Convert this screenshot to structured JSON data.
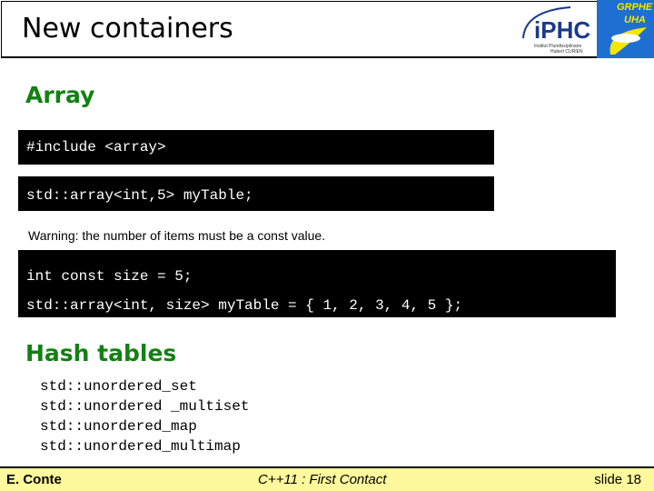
{
  "header": {
    "title": "New containers",
    "logo_iphc": "IPHC",
    "logo_iphc_sub": "Institut Pluridisciplinaire Hubert CURIEN STRASBOURG",
    "logo_grphe": "GRPHE UHA"
  },
  "array": {
    "heading": "Array",
    "code1": "#include <array>",
    "code2": "std::array<int,5> myTable;",
    "warning": "Warning: the number of items must be a const value.",
    "code3_line1": "int const size = 5;",
    "code3_line2": "std::array<int, size> myTable = { 1, 2, 3, 4, 5 };"
  },
  "hash": {
    "heading": "Hash tables",
    "items": [
      "std::unordered_set",
      "std::unordered _multiset",
      "std::unordered_map",
      "std::unordered_multimap"
    ]
  },
  "footer": {
    "author": "E. Conte",
    "title": "C++11 : First Contact",
    "slide": "slide 18"
  },
  "colors": {
    "heading": "#138013",
    "footer_bg": "#fef99c",
    "code_bg": "#000000"
  }
}
